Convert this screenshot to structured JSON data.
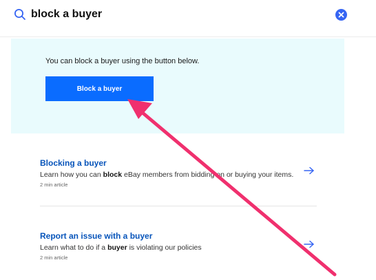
{
  "search": {
    "query": "block a buyer",
    "icon": "search-icon",
    "clear_icon": "close-icon"
  },
  "answer": {
    "text": "You can block a buyer using the button below.",
    "button_label": "Block a buyer"
  },
  "articles": [
    {
      "title": "Blocking a buyer",
      "desc_pre": "Learn how you can ",
      "desc_bold": "block",
      "desc_post": " eBay members from bidding on or buying your items.",
      "meta": "2 min article",
      "icon": "arrow-right-icon"
    },
    {
      "title": "Report an issue with a buyer",
      "desc_pre": "Learn what to do if a ",
      "desc_bold": "buyer",
      "desc_post": " is violating our policies",
      "meta": "2 min article",
      "icon": "arrow-right-icon"
    }
  ],
  "annotation": {
    "arrow_color": "#f0306e"
  },
  "colors": {
    "accent": "#0a6cff",
    "link": "#0654ba",
    "card_bg": "#e9fbfd"
  }
}
